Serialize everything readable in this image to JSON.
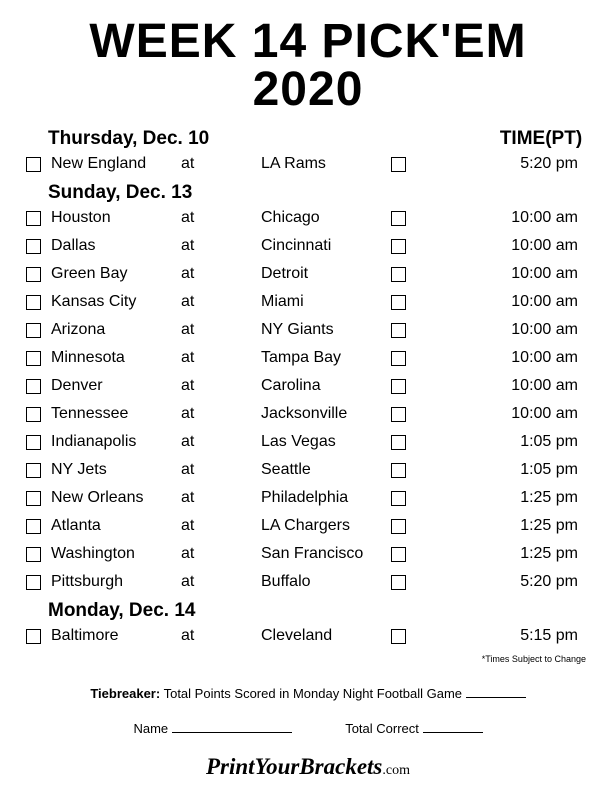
{
  "title_line1": "WEEK 14 PICK'EM",
  "title_line2": "2020",
  "time_heading": "TIME(PT)",
  "days": [
    {
      "heading": "Thursday, Dec. 10",
      "games": [
        {
          "away": "New England",
          "at": "at",
          "home": "LA Rams",
          "time": "5:20 pm"
        }
      ]
    },
    {
      "heading": "Sunday, Dec. 13",
      "games": [
        {
          "away": "Houston",
          "at": "at",
          "home": "Chicago",
          "time": "10:00 am"
        },
        {
          "away": "Dallas",
          "at": "at",
          "home": "Cincinnati",
          "time": "10:00 am"
        },
        {
          "away": "Green Bay",
          "at": "at",
          "home": "Detroit",
          "time": "10:00 am"
        },
        {
          "away": "Kansas City",
          "at": "at",
          "home": "Miami",
          "time": "10:00 am"
        },
        {
          "away": "Arizona",
          "at": "at",
          "home": "NY Giants",
          "time": "10:00 am"
        },
        {
          "away": "Minnesota",
          "at": "at",
          "home": "Tampa Bay",
          "time": "10:00 am"
        },
        {
          "away": "Denver",
          "at": "at",
          "home": "Carolina",
          "time": "10:00 am"
        },
        {
          "away": "Tennessee",
          "at": "at",
          "home": "Jacksonville",
          "time": "10:00 am"
        },
        {
          "away": "Indianapolis",
          "at": "at",
          "home": "Las Vegas",
          "time": "1:05 pm"
        },
        {
          "away": "NY Jets",
          "at": "at",
          "home": "Seattle",
          "time": "1:05 pm"
        },
        {
          "away": "New Orleans",
          "at": "at",
          "home": "Philadelphia",
          "time": "1:25 pm"
        },
        {
          "away": "Atlanta",
          "at": "at",
          "home": "LA Chargers",
          "time": "1:25 pm"
        },
        {
          "away": "Washington",
          "at": "at",
          "home": "San Francisco",
          "time": "1:25 pm"
        },
        {
          "away": "Pittsburgh",
          "at": "at",
          "home": "Buffalo",
          "time": "5:20 pm"
        }
      ]
    },
    {
      "heading": "Monday, Dec. 14",
      "games": [
        {
          "away": "Baltimore",
          "at": "at",
          "home": "Cleveland",
          "time": "5:15 pm"
        }
      ]
    }
  ],
  "disclaimer": "*Times Subject to Change",
  "tiebreaker_label": "Tiebreaker:",
  "tiebreaker_text": "Total Points Scored in Monday Night Football Game",
  "name_label": "Name",
  "total_correct_label": "Total Correct",
  "footer_bold": "PrintYourBrackets",
  "footer_com": ".com"
}
